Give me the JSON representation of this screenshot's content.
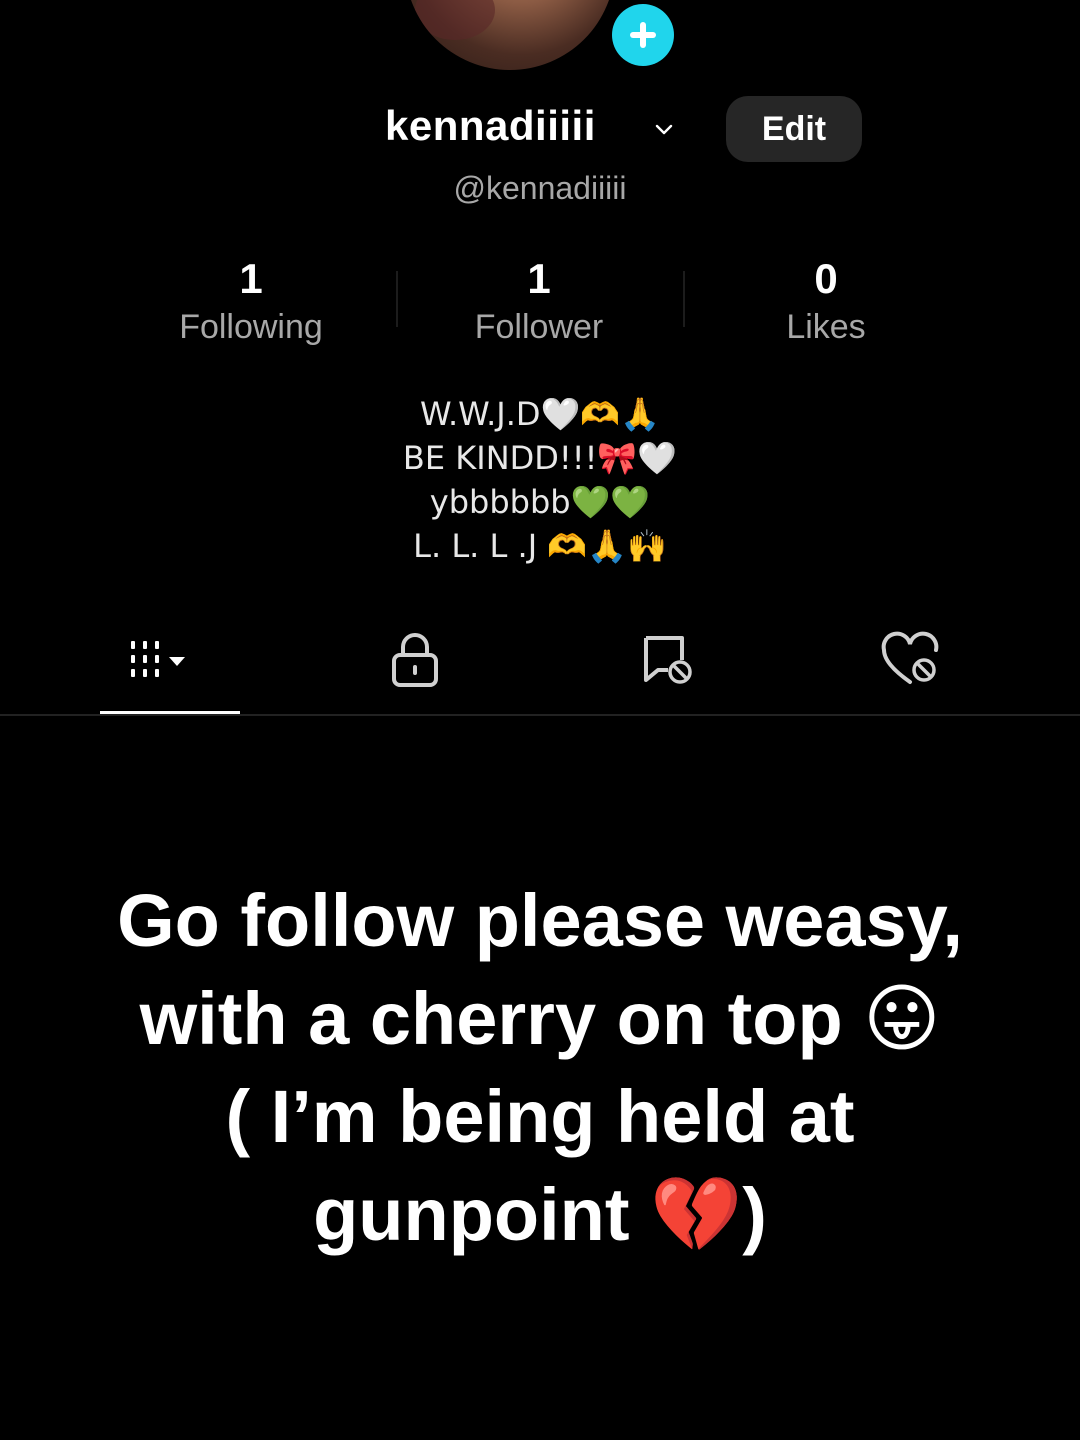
{
  "profile": {
    "username": "kennadiiiii",
    "handle": "@kennadiiiii",
    "edit_label": "Edit"
  },
  "stats": {
    "following": {
      "value": "1",
      "label": "Following"
    },
    "followers": {
      "value": "1",
      "label": "Follower"
    },
    "likes": {
      "value": "0",
      "label": "Likes"
    }
  },
  "bio": {
    "lines": [
      "W.W.J.D🤍🫶🙏",
      "BE KINDD!!!🎀🤍",
      "ybbbbbb💚💚",
      "L. L. L .J 🫶🙏🙌"
    ]
  },
  "tabs": {
    "items": [
      "videos-grid-icon",
      "lock-icon",
      "repost-icon",
      "liked-icon"
    ],
    "active": "videos"
  },
  "caption": {
    "lines": [
      "Go follow please weasy,",
      "with a cherry on top 😛",
      "( I’m being held at",
      "gunpoint 💔)"
    ]
  },
  "colors": {
    "background": "#000000",
    "accent_plus": "#20d5ec",
    "edit_button_bg": "#262626",
    "secondary_text": "#a8a8a8"
  }
}
